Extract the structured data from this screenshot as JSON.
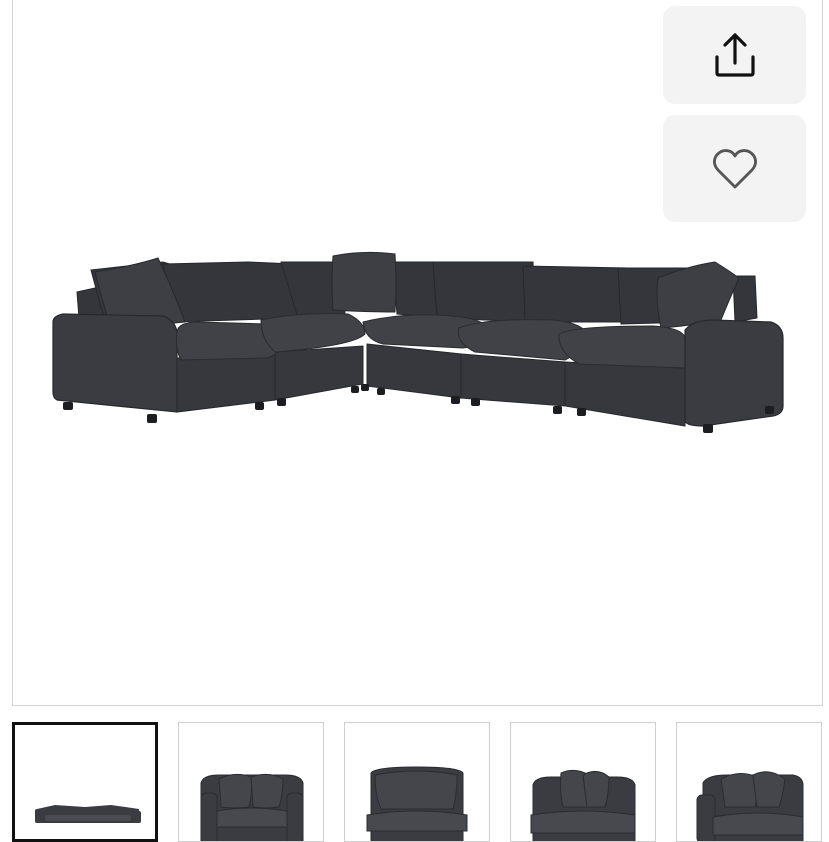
{
  "gallery": {
    "main_image": {
      "alt": "",
      "subject": "sectional-sofa"
    },
    "actions": {
      "share_icon": "share-upload-icon",
      "favorite_icon": "heart-outline-icon"
    },
    "thumbnails": [
      {
        "subject": "full-sectional",
        "selected": true
      },
      {
        "subject": "armless-chair-with-pillows",
        "selected": false
      },
      {
        "subject": "armless-chair",
        "selected": false
      },
      {
        "subject": "corner-chair",
        "selected": false
      },
      {
        "subject": "left-arm-chair",
        "selected": false
      }
    ]
  },
  "colors": {
    "fabric": "#3a3c41",
    "fabric_dark": "#2b2d31",
    "button_bg": "#f3f3f3",
    "selected_border": "#111111"
  }
}
